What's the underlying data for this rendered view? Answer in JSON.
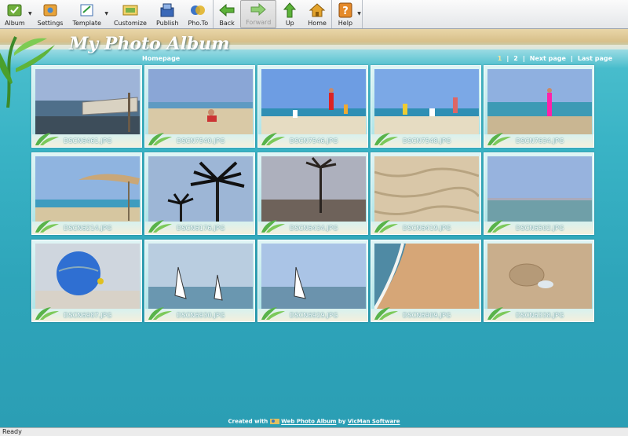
{
  "toolbar": {
    "album": "Album",
    "settings": "Settings",
    "template": "Template",
    "customize": "Customize",
    "publish": "Publish",
    "phoTo": "Pho.To",
    "back": "Back",
    "forward": "Forward",
    "up": "Up",
    "home": "Home",
    "help": "Help"
  },
  "album": {
    "title": "My Photo Album",
    "homepage": "Homepage",
    "pager": {
      "page1": "1",
      "sep": "|",
      "page2": "2",
      "next": "Next page",
      "last": "Last page"
    }
  },
  "photos": [
    {
      "caption": "DSCN6461.JPG",
      "scene": "sign"
    },
    {
      "caption": "DSCN7540.JPG",
      "scene": "beach-kid"
    },
    {
      "caption": "DSCN7546.JPG",
      "scene": "beach-kids"
    },
    {
      "caption": "DSCN7548.JPG",
      "scene": "beach-kids2"
    },
    {
      "caption": "DSCN7634.JPG",
      "scene": "beach-girl"
    },
    {
      "caption": "DSCN6214.JPG",
      "scene": "umbrella"
    },
    {
      "caption": "DSCN6176.JPG",
      "scene": "palms"
    },
    {
      "caption": "DSCN6434.JPG",
      "scene": "palm-sunset"
    },
    {
      "caption": "DSCN6419.JPG",
      "scene": "sand"
    },
    {
      "caption": "DSCN6502.JPG",
      "scene": "sea"
    },
    {
      "caption": "DSCN6987.JPG",
      "scene": "parasail"
    },
    {
      "caption": "DSCN6930.JPG",
      "scene": "windsurf"
    },
    {
      "caption": "DSCN6929.JPG",
      "scene": "windsurf2"
    },
    {
      "caption": "DSCN6909.JPG",
      "scene": "shore"
    },
    {
      "caption": "DSCN6338.JPG",
      "scene": "footprint"
    }
  ],
  "footer": {
    "created_with": "Created with",
    "product": "Web Photo Album",
    "by": "by",
    "vendor": "VicMan Software"
  },
  "status": "Ready"
}
